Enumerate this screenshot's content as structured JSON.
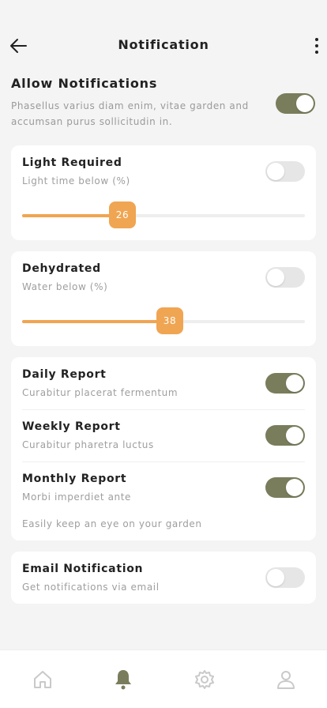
{
  "header": {
    "title": "Notification",
    "back_icon": "arrow-left-icon",
    "more_icon": "more-vertical-icon"
  },
  "allow": {
    "title": "Allow Notifications",
    "description": "Phasellus varius diam enim, vitae garden and accumsan purus sollicitudin in.",
    "enabled": true
  },
  "cards": {
    "light": {
      "title": "Light Required",
      "subtitle": "Light time below (%)",
      "enabled": false,
      "value": 26
    },
    "dehydrated": {
      "title": "Dehydrated",
      "subtitle": "Water below (%)",
      "enabled": false,
      "value": 38
    },
    "reports": {
      "items": [
        {
          "title": "Daily Report",
          "subtitle": "Curabitur placerat fermentum",
          "enabled": true
        },
        {
          "title": "Weekly Report",
          "subtitle": "Curabitur pharetra luctus",
          "enabled": true
        },
        {
          "title": "Monthly Report",
          "subtitle": "Morbi imperdiet ante",
          "enabled": true
        }
      ],
      "note": "Easily keep an eye on your garden"
    },
    "email": {
      "title": "Email Notification",
      "subtitle": "Get notifications via email",
      "enabled": false
    }
  },
  "tabbar": {
    "items": [
      {
        "icon": "home-icon",
        "active": false
      },
      {
        "icon": "bell-icon",
        "active": true
      },
      {
        "icon": "gear-icon",
        "active": false
      },
      {
        "icon": "user-icon",
        "active": false
      }
    ]
  },
  "colors": {
    "toggle_on": "#7a7d5c",
    "toggle_off": "#e6e6e6",
    "slider_accent": "#f0a552",
    "tab_active": "#7a7d5c",
    "tab_inactive": "#c9c9c9"
  }
}
